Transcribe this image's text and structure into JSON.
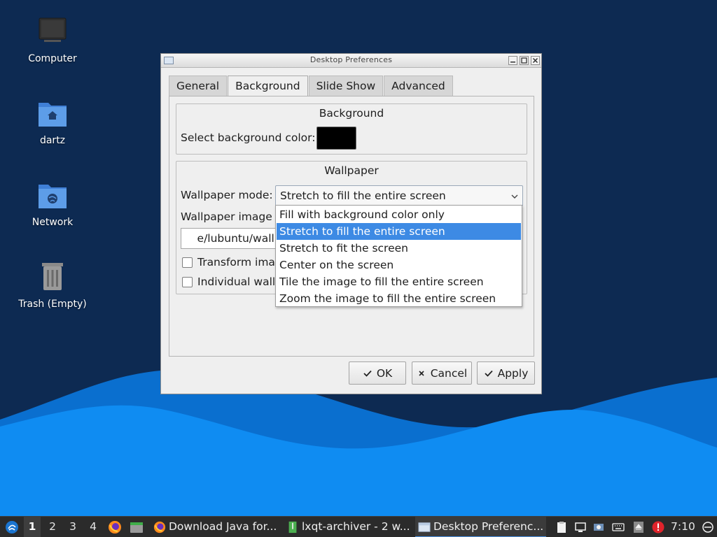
{
  "desktop": {
    "icons": [
      {
        "label": "Computer"
      },
      {
        "label": "dartz"
      },
      {
        "label": "Network"
      },
      {
        "label": "Trash (Empty)"
      }
    ],
    "colors": {
      "sky": "#0d2a52",
      "wave_front": "#0f8cf2",
      "wave_back": "#0a6fcf"
    }
  },
  "window": {
    "title": "Desktop Preferences",
    "tabs": [
      {
        "label": "General"
      },
      {
        "label": "Background",
        "active": true
      },
      {
        "label": "Slide Show"
      },
      {
        "label": "Advanced"
      }
    ],
    "background_group": {
      "title": "Background",
      "color_label": "Select background color:",
      "color_value": "#000000"
    },
    "wallpaper_group": {
      "title": "Wallpaper",
      "mode_label": "Wallpaper mode:",
      "mode_value": "Stretch to fill the entire screen",
      "image_label": "Wallpaper image f",
      "path_value": "e/lubuntu/wallpap",
      "transform_label": "Transform imag",
      "individual_label": "Individual wallp"
    },
    "dropdown": {
      "options": [
        {
          "label": "Fill with background color only"
        },
        {
          "label": "Stretch to fill the entire screen",
          "selected": true
        },
        {
          "label": "Stretch to fit the screen"
        },
        {
          "label": "Center on the screen"
        },
        {
          "label": "Tile the image to fill the entire screen"
        },
        {
          "label": "Zoom the image to fill the entire screen"
        }
      ]
    },
    "buttons": {
      "ok": "OK",
      "cancel": "Cancel",
      "apply": "Apply"
    }
  },
  "taskbar": {
    "workspaces": [
      "1",
      "2",
      "3",
      "4"
    ],
    "active_workspace": "1",
    "tasks": [
      {
        "label": "Download Java for...",
        "icon": "firefox-icon"
      },
      {
        "label": "lxqt-archiver - 2 w...",
        "icon": "archiver-icon"
      },
      {
        "label": "Desktop Preferenc...",
        "icon": "window-icon",
        "active": true
      }
    ],
    "clock": "7:10"
  }
}
